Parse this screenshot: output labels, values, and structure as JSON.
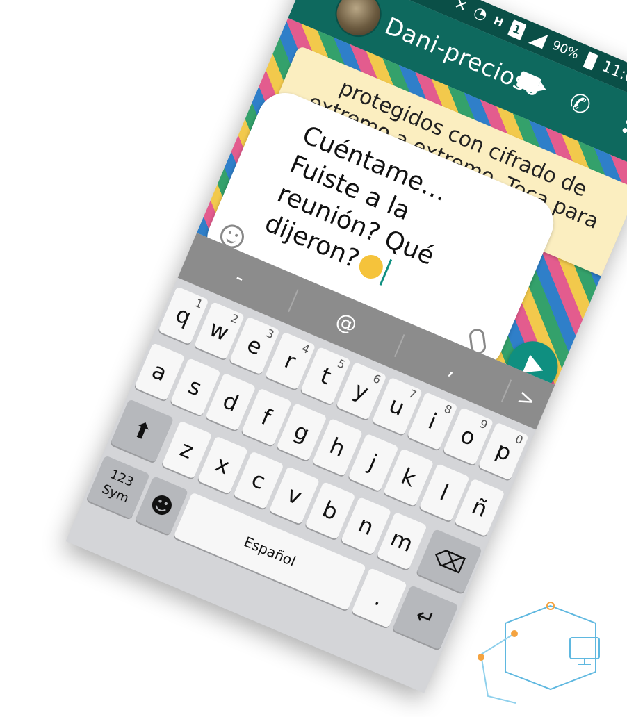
{
  "status_bar": {
    "battery": "90%",
    "time": "11:02 AM",
    "h_label": "H",
    "sim_label": "1"
  },
  "header": {
    "back_icon": "←",
    "contact_name": "Dani-precioso",
    "phone_icon": "✆"
  },
  "chat": {
    "system_message": "protegidos con cifrado de extremo a extremo. Toca para más información."
  },
  "composer": {
    "text": "Cuéntame… Fuiste a la reunión?  Qué dijeron?"
  },
  "keyboard": {
    "suggestions": [
      "-",
      "@",
      ",",
      ">"
    ],
    "row1": [
      {
        "k": "q",
        "n": "1"
      },
      {
        "k": "w",
        "n": "2"
      },
      {
        "k": "e",
        "n": "3"
      },
      {
        "k": "r",
        "n": "4"
      },
      {
        "k": "t",
        "n": "5"
      },
      {
        "k": "y",
        "n": "6"
      },
      {
        "k": "u",
        "n": "7"
      },
      {
        "k": "i",
        "n": "8"
      },
      {
        "k": "o",
        "n": "9"
      },
      {
        "k": "p",
        "n": "0"
      }
    ],
    "row2": [
      "a",
      "s",
      "d",
      "f",
      "g",
      "h",
      "j",
      "k",
      "l",
      "ñ"
    ],
    "row3": [
      "z",
      "x",
      "c",
      "v",
      "b",
      "n",
      "m"
    ],
    "shift_label": "⬆",
    "backspace_label": "⌫",
    "sym_label": "123 Sym",
    "emoji_label": "☻",
    "space_label": "Español",
    "period_label": ".",
    "enter_label": "↵"
  }
}
